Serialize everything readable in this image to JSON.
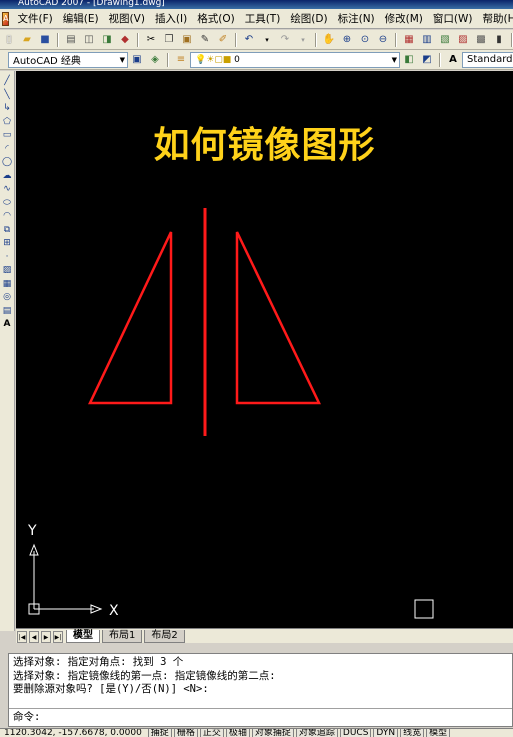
{
  "window": {
    "title": "AutoCAD 2007 - [Drawing1.dwg]"
  },
  "menu": [
    "文件(F)",
    "编辑(E)",
    "视图(V)",
    "插入(I)",
    "格式(O)",
    "工具(T)",
    "绘图(D)",
    "标注(N)",
    "修改(M)",
    "窗口(W)",
    "帮助(H)"
  ],
  "toolbar2": {
    "workspace": "AutoCAD 经典",
    "layer": "0",
    "text_style": "Standard"
  },
  "canvas": {
    "heading": "如何镜像图形",
    "ucs_y": "Y",
    "ucs_x": "X",
    "colors": {
      "background": "#000000",
      "shape": "#ff1a1a",
      "heading": "#ffd21a"
    }
  },
  "tabs": [
    "模型",
    "布局1",
    "布局2"
  ],
  "command": {
    "lines": [
      "选择对象: 指定对角点: 找到 3 个",
      "选择对象:  指定镜像线的第一点: 指定镜像线的第二点:",
      "要删除源对象吗? [是(Y)/否(N)] <N>:"
    ],
    "prompt": "命令:"
  },
  "status": {
    "coords": "1120.3042, -157.6678, 0.0000",
    "buttons": [
      "捕捉",
      "栅格",
      "正交",
      "极轴",
      "对象捕捉",
      "对象追踪",
      "DUCS",
      "DYN",
      "线宽",
      "模型"
    ]
  }
}
